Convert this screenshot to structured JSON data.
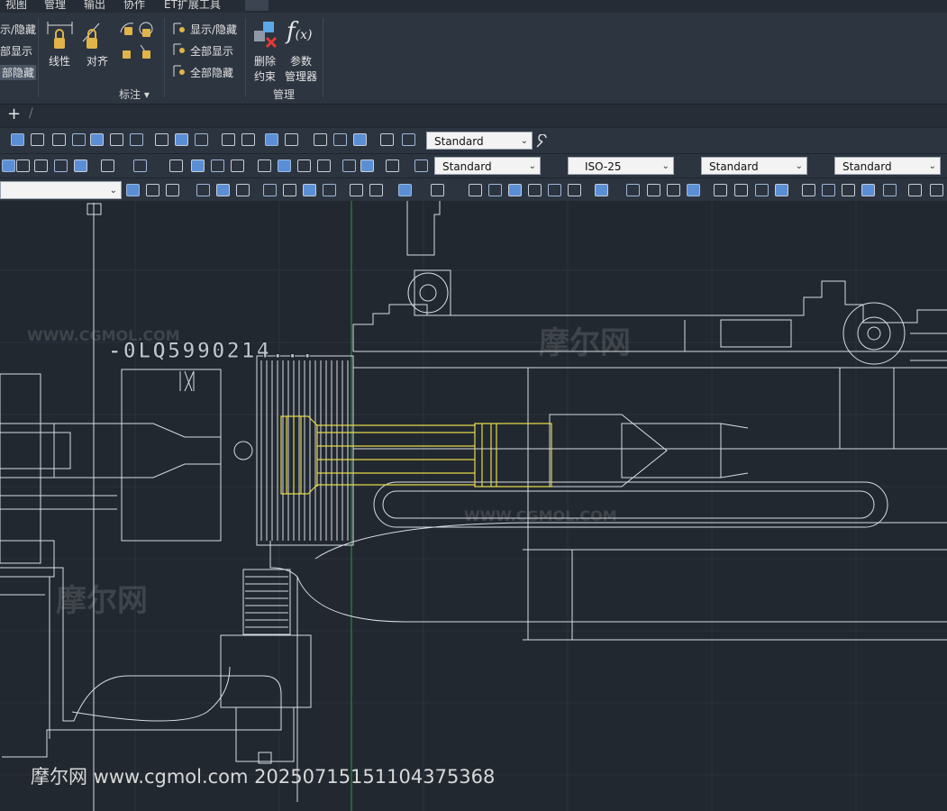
{
  "menubar": {
    "items": [
      "视图",
      "管理",
      "输出",
      "协作",
      "ET扩展工具"
    ]
  },
  "ribbon": {
    "left_partial": [
      "示/隐藏",
      "部显示",
      "部隐藏"
    ],
    "dimension_group": {
      "linetype": "线性",
      "align": "对齐",
      "title": "标注"
    },
    "constraint_display": [
      "显示/隐藏",
      "全部显示",
      "全部隐藏"
    ],
    "manage": {
      "delete": "删除",
      "delete2": "约束",
      "params": "参数",
      "params2": "管理器",
      "title": "管理"
    }
  },
  "tabs": {
    "add": "+",
    "sep": "/"
  },
  "toolbar1": {
    "style_combo": "Standard"
  },
  "toolbar2": {
    "text_style": "Standard",
    "dim_style": "ISO-25",
    "table_style": "Standard",
    "multileader_style": "Standard"
  },
  "drawing": {
    "blurred_label": "-0LQ5990214..."
  },
  "watermark": {
    "text": "摩尔网 www.cgmol.com 20250715151104375368",
    "logo": "摩尔网",
    "logo_sub": "WWW.CGMOL.COM"
  },
  "colors": {
    "bg": "#212830",
    "ribbon": "#2d3540",
    "line": "#d9dde2",
    "highlight": "#e6d84a",
    "axis": "#2f9a3a"
  }
}
